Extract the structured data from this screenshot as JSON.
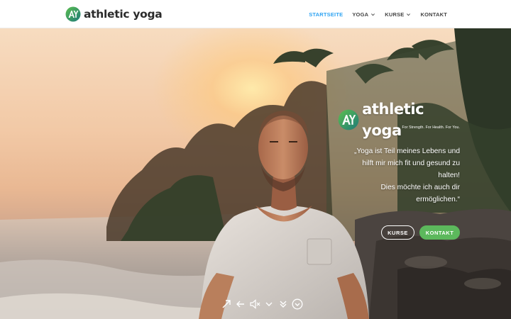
{
  "brand": {
    "name": "athletic yoga",
    "mark_letters": "AY",
    "accent": "#2ea3f2",
    "cta_green": "#5cb85c",
    "logo_green": "#4caf50",
    "logo_teal": "#1e7a78"
  },
  "nav": {
    "items": [
      {
        "label": "STARTSEITE",
        "active": true,
        "dropdown": false
      },
      {
        "label": "YOGA",
        "active": false,
        "dropdown": true
      },
      {
        "label": "KURSE",
        "active": false,
        "dropdown": true
      },
      {
        "label": "KONTAKT",
        "active": false,
        "dropdown": false
      }
    ]
  },
  "hero": {
    "logo_text": "athletic yoga",
    "tagline": "For Strength. For Health. For You.",
    "quote_lines": [
      "„Yoga ist Teil meines Lebens und",
      "hilft mir mich fit und gesund zu",
      "halten!",
      "Dies möchte ich auch dir",
      "ermöglichen.“"
    ],
    "buttons": {
      "kurse": "KURSE",
      "kontakt": "KONTAKT"
    }
  },
  "player": {
    "icons": [
      "expand-icon",
      "collapse-icon",
      "mute-icon",
      "chevron-down-icon",
      "double-chevron-down-icon",
      "scroll-down-circle-icon"
    ]
  }
}
